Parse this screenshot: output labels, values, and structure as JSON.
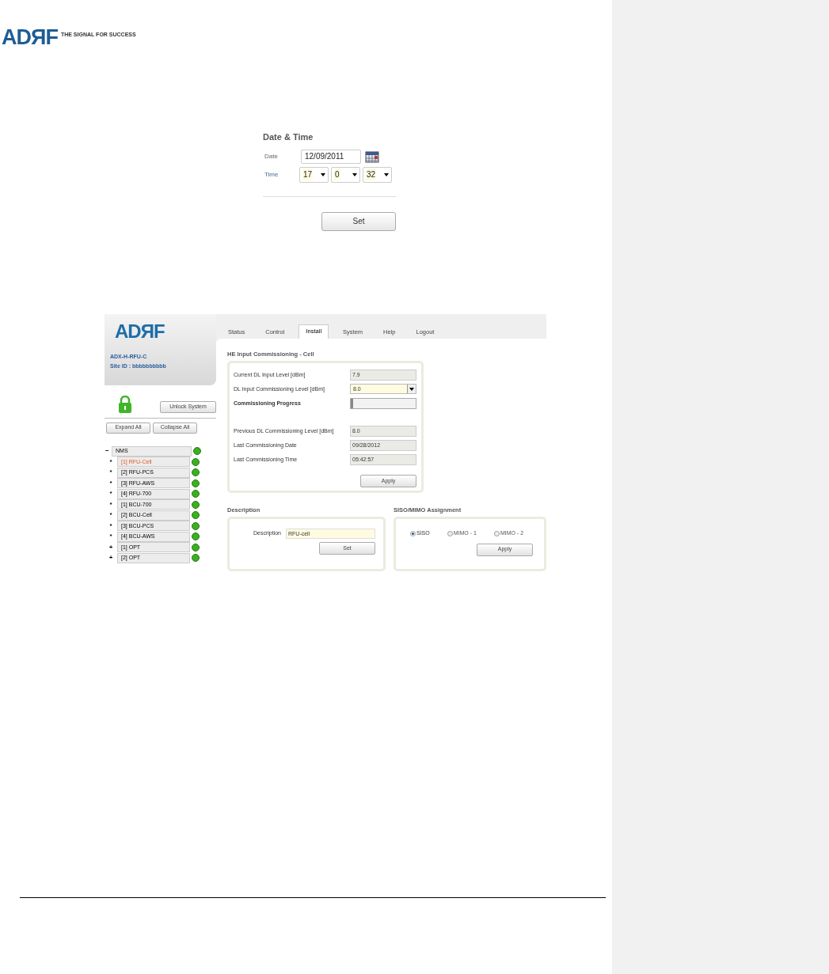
{
  "document_header": {
    "logo": "ADЯF",
    "tagline": "THE SIGNAL FOR SUCCESS"
  },
  "date_time": {
    "title": "Date & Time",
    "date_label": "Date",
    "date_value": "12/09/2011",
    "time_label": "Time",
    "time_selects": [
      "17",
      "0",
      "32"
    ],
    "button": "Set"
  },
  "app": {
    "logo": "ADЯF",
    "device": "ADX-H-RFU-C",
    "site_id": "Site ID : bbbbbbbbbb",
    "locked": true,
    "unlock_button": "Unlock System",
    "expand_button": "Expand All",
    "collapse_button": "Collapse All",
    "tree": [
      {
        "marker": "−",
        "label": "NMS",
        "color": "#3cb020",
        "selected": false,
        "children": [
          {
            "marker": "*",
            "label": "[1] RFU-Cell",
            "color": "#3cb020",
            "selected": true
          },
          {
            "marker": "*",
            "label": "[2] RFU-PCS",
            "color": "#3cb020",
            "selected": false
          },
          {
            "marker": "*",
            "label": "[3] RFU-AWS",
            "color": "#3cb020",
            "selected": false
          },
          {
            "marker": "*",
            "label": "[4] RFU-700",
            "color": "#3cb020",
            "selected": false
          },
          {
            "marker": "*",
            "label": "[1] BCU-700",
            "color": "#3cb020",
            "selected": false
          },
          {
            "marker": "*",
            "label": "[2] BCU-Cell",
            "color": "#3cb020",
            "selected": false
          },
          {
            "marker": "*",
            "label": "[3] BCU-PCS",
            "color": "#3cb020",
            "selected": false
          },
          {
            "marker": "*",
            "label": "[4] BCU-AWS",
            "color": "#3cb020",
            "selected": false
          },
          {
            "marker": "+",
            "label": "[1] OPT",
            "color": "#3cb020",
            "selected": false
          },
          {
            "marker": "+",
            "label": "[2] OPT",
            "color": "#3cb020",
            "selected": false
          }
        ]
      }
    ],
    "tabs": [
      {
        "label": "Status",
        "selected": false
      },
      {
        "label": "Control",
        "selected": false
      },
      {
        "label": "Install",
        "selected": true
      },
      {
        "label": "System",
        "selected": false
      },
      {
        "label": "Help",
        "selected": false
      },
      {
        "label": "Logout",
        "selected": false
      }
    ],
    "commissioning": {
      "title": "HE Input Commissioning - Cell",
      "fields": [
        {
          "kind": "readonly",
          "label": "Current DL Input Level [dBm]",
          "value": "7.9"
        },
        {
          "kind": "select",
          "label": "DL Input Commissioning Level [dBm]",
          "value": "8.0"
        },
        {
          "kind": "progress",
          "label": "Commissioning Progress",
          "level": 0
        },
        {
          "kind": "readonly",
          "label": "Previous DL Commissioning Level [dBm]",
          "value": "8.0"
        },
        {
          "kind": "readonly",
          "label": "Last Commissioning Date",
          "value": "09/28/2012"
        },
        {
          "kind": "readonly",
          "label": "Last Commissioning Time",
          "value": "05:42:57"
        }
      ],
      "button": "Apply"
    },
    "description": {
      "title": "Description",
      "label": "Description",
      "value": "RFU-cell",
      "button": "Set"
    },
    "siso_mimo": {
      "title": "SISO/MIMO Assignment",
      "options": [
        {
          "label": "SISO",
          "selected": true
        },
        {
          "label": "MIMO - 1",
          "selected": false
        },
        {
          "label": "MIMO - 2",
          "selected": false
        }
      ],
      "button": "Apply"
    }
  }
}
